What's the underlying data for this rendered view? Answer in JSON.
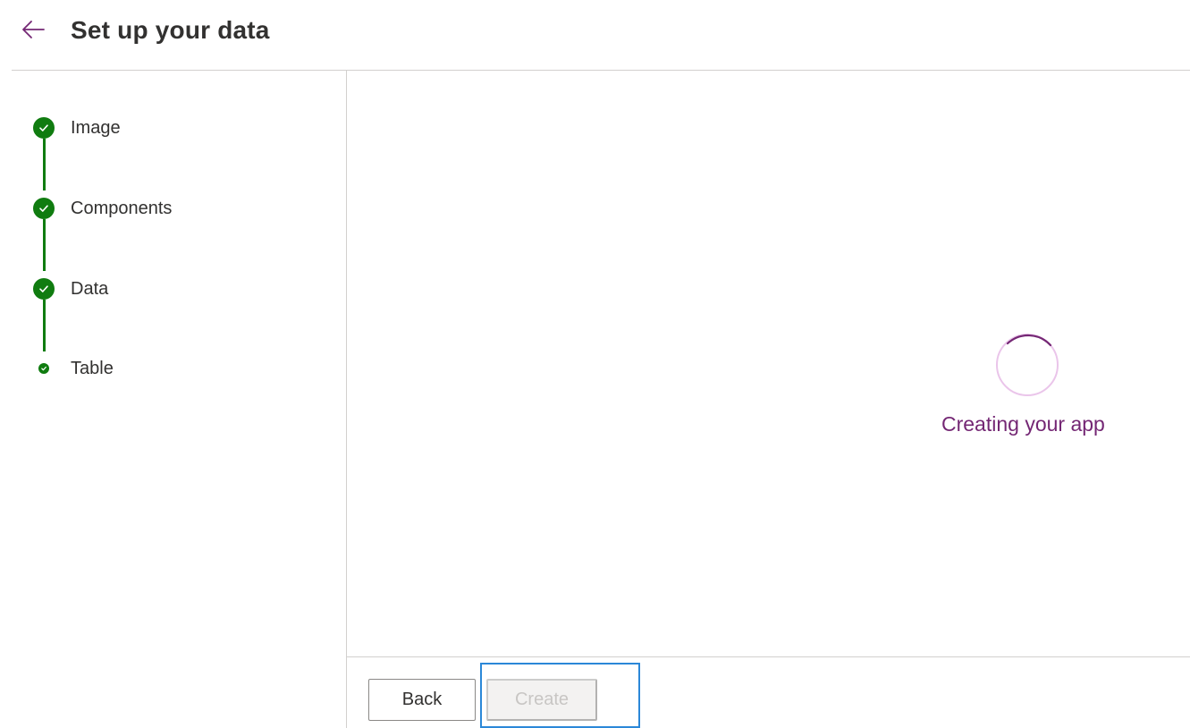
{
  "header": {
    "title": "Set up your data",
    "back_icon": "arrow-left-icon"
  },
  "steps": [
    {
      "label": "Image",
      "status": "complete"
    },
    {
      "label": "Components",
      "status": "complete"
    },
    {
      "label": "Data",
      "status": "complete"
    },
    {
      "label": "Table",
      "status": "current"
    }
  ],
  "main": {
    "loading_text": "Creating your app"
  },
  "footer": {
    "back_label": "Back",
    "create_label": "Create"
  },
  "colors": {
    "accent": "#742774",
    "success": "#107c10",
    "focus": "#2b88d8"
  }
}
